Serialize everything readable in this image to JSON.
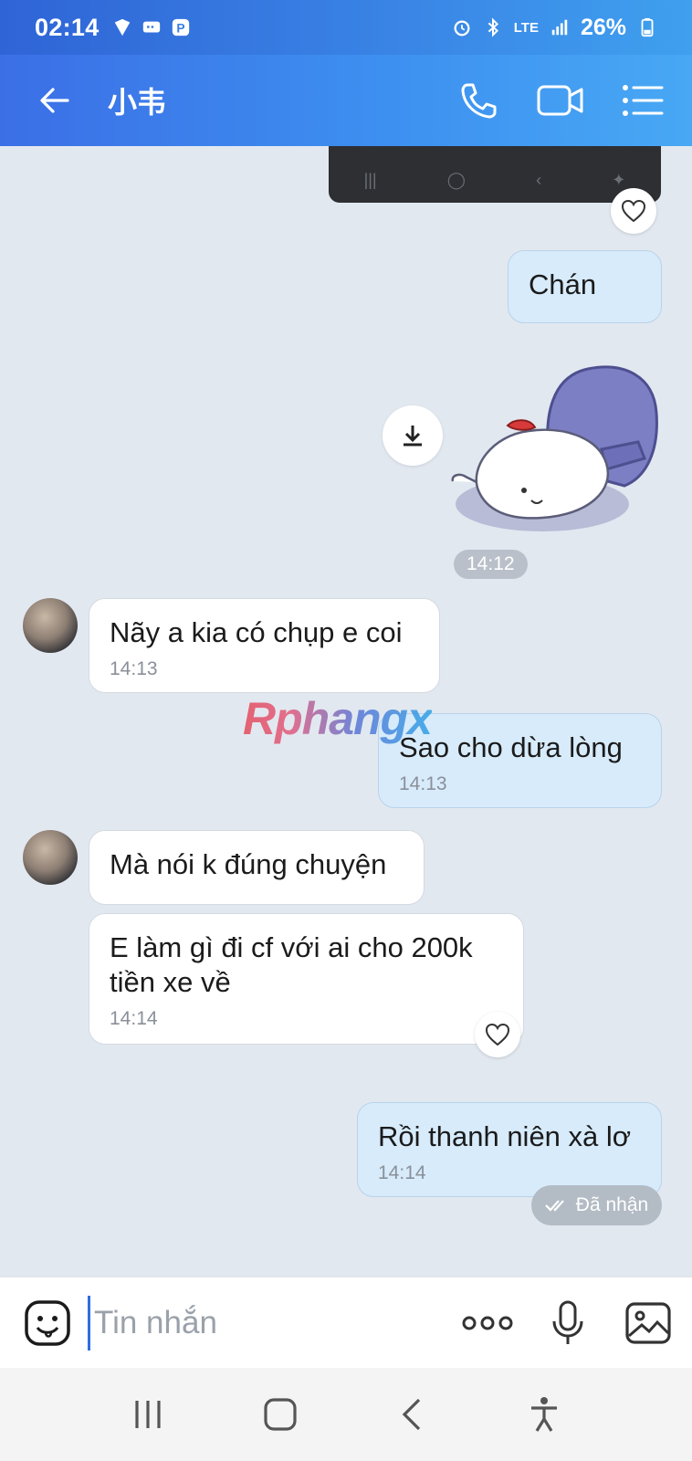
{
  "status_bar": {
    "time": "02:14",
    "battery": "26%",
    "network": "LTE"
  },
  "header": {
    "back_icon": "arrow-left-icon",
    "title": "小韦",
    "call_icon": "phone-icon",
    "video_icon": "video-camera-icon",
    "menu_icon": "list-menu-icon"
  },
  "messages": [
    {
      "side": "out",
      "text": "Chán"
    },
    {
      "side": "out",
      "type": "sticker",
      "time": "14:12"
    },
    {
      "side": "in",
      "text": "Nãy a kia có chụp e coi",
      "time": "14:13"
    },
    {
      "side": "out",
      "text": "Sao cho dừa lòng",
      "time": "14:13"
    },
    {
      "side": "in",
      "text": "Mà nói k đúng chuyện"
    },
    {
      "side": "in",
      "text": "E làm gì đi cf với ai cho 200k tiền xe về",
      "time": "14:14"
    },
    {
      "side": "out",
      "text": "Rồi thanh niên xà lơ",
      "time": "14:14"
    }
  ],
  "message_status": "Đã nhận",
  "watermark": "Rphangx",
  "input": {
    "placeholder": "Tin nhắn"
  },
  "colors": {
    "header_start": "#3b6fe6",
    "header_end": "#48a8f4",
    "bubble_out": "#d7ebfb",
    "bubble_in": "#ffffff",
    "chat_bg": "#e2e8f0"
  }
}
